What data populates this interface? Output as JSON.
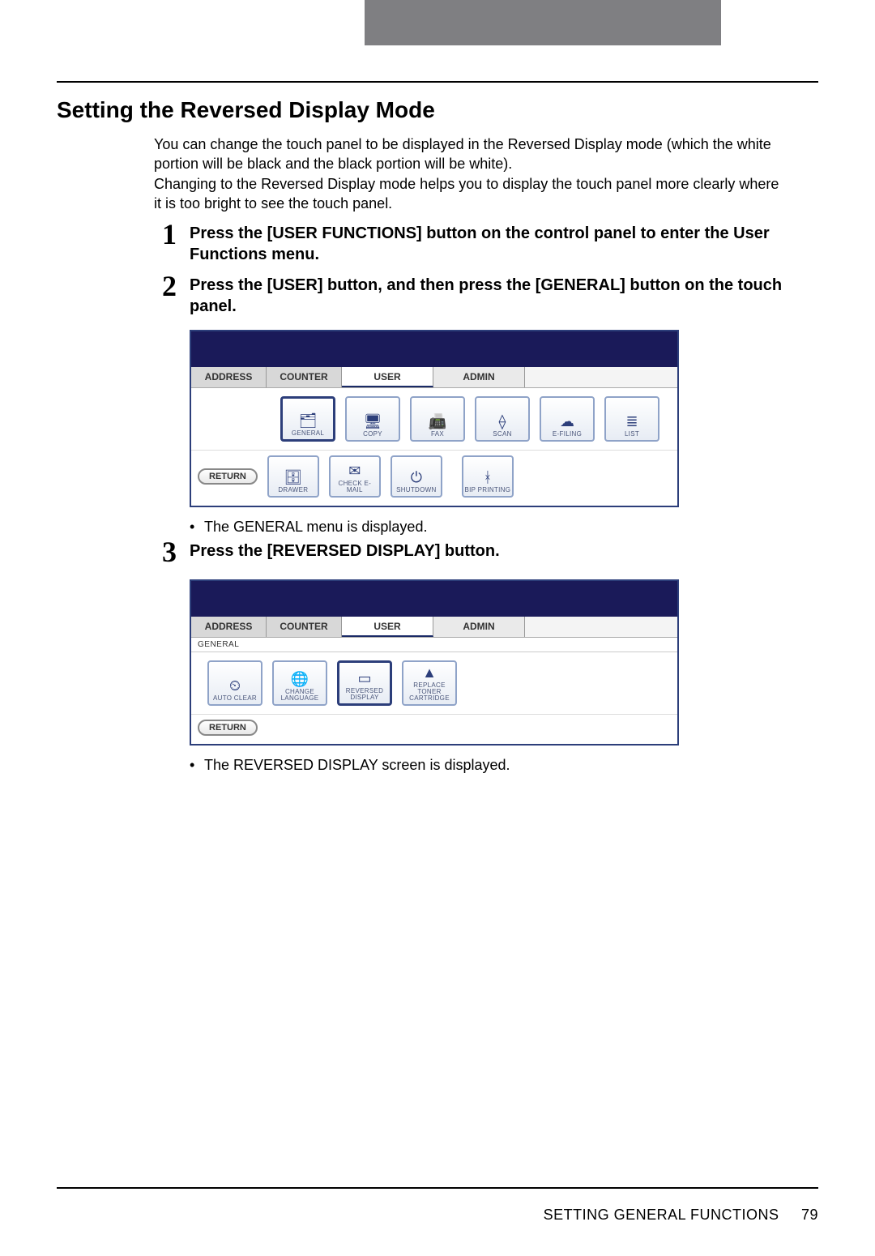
{
  "header": {
    "title": "Setting the Reversed Display Mode"
  },
  "intro": {
    "p1": "You can change the touch panel to be displayed in the Reversed Display mode (which the white portion will be black and the black portion will be white).",
    "p2": "Changing to the Reversed Display mode helps you to display the touch panel more clearly where it is too bright to see the touch panel."
  },
  "steps": {
    "s1": {
      "num": "1",
      "text": "Press the [USER FUNCTIONS] button on the control panel to enter the User Functions menu."
    },
    "s2": {
      "num": "2",
      "text": "Press the [USER] button, and then press the [GENERAL] button on the touch panel."
    },
    "s3": {
      "num": "3",
      "text": "Press the [REVERSED DISPLAY] button."
    }
  },
  "notes": {
    "after2": "The GENERAL menu is displayed.",
    "after3": "The REVERSED DISPLAY screen is displayed."
  },
  "panel1": {
    "tabs": {
      "address": "ADDRESS",
      "counter": "COUNTER",
      "user": "USER",
      "admin": "ADMIN"
    },
    "row1": {
      "general": "GENERAL",
      "copy": "COPY",
      "fax": "FAX",
      "scan": "SCAN",
      "efiling": "E-FILING",
      "list": "LIST"
    },
    "row2": {
      "drawer": "DRAWER",
      "checkemail": "CHECK E-MAIL",
      "shutdown": "SHUTDOWN",
      "bipprinting": "BIP PRINTING"
    },
    "return": "RETURN"
  },
  "panel2": {
    "tabs": {
      "address": "ADDRESS",
      "counter": "COUNTER",
      "user": "USER",
      "admin": "ADMIN"
    },
    "sub": "GENERAL",
    "row": {
      "autoclear": "AUTO CLEAR",
      "changelang": "CHANGE\nLANGUAGE",
      "revdisp": "REVERSED\nDISPLAY",
      "replacetoner": "REPLACE\nTONER\nCARTRIDGE"
    },
    "return": "RETURN"
  },
  "footer": {
    "section": "SETTING GENERAL FUNCTIONS",
    "page": "79"
  }
}
